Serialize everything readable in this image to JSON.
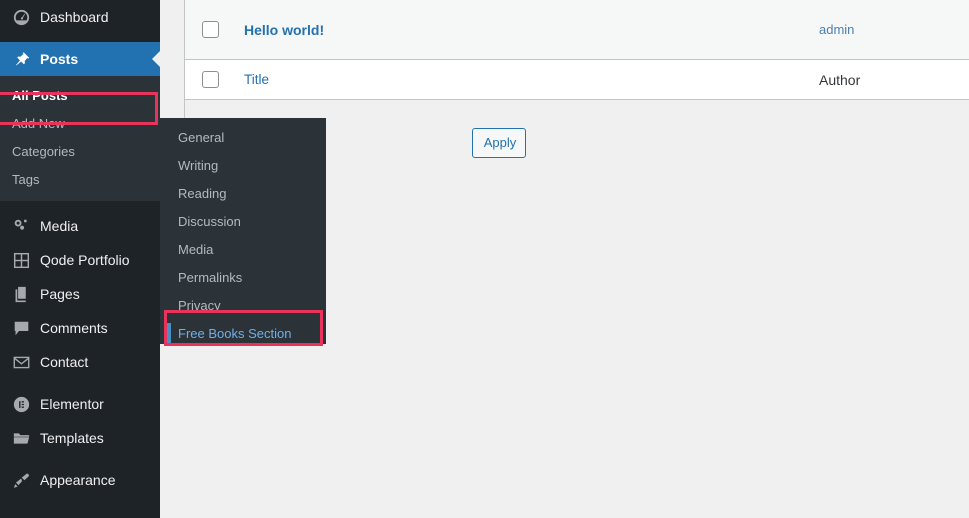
{
  "colors": {
    "sidebar_bg": "#1d2327",
    "submenu_bg": "#2c3338",
    "active_blue": "#2271b1",
    "link_blue": "#2271b1",
    "highlight_red": "#e8345a",
    "page_bg": "#f0f0f1",
    "selected_sub_blue": "#72aee6"
  },
  "sidebar": {
    "items": [
      {
        "label": "Dashboard",
        "icon": "dashboard-icon",
        "active": false
      },
      {
        "label": "Posts",
        "icon": "pin-icon",
        "active": true
      },
      {
        "label": "Media",
        "icon": "media-icon",
        "active": false
      },
      {
        "label": "Qode Portfolio",
        "icon": "grid-icon",
        "active": false
      },
      {
        "label": "Pages",
        "icon": "pages-icon",
        "active": false
      },
      {
        "label": "Comments",
        "icon": "comment-icon",
        "active": false
      },
      {
        "label": "Contact",
        "icon": "envelope-icon",
        "active": false
      },
      {
        "label": "Elementor",
        "icon": "elementor-icon",
        "active": false
      },
      {
        "label": "Templates",
        "icon": "folder-icon",
        "active": false
      },
      {
        "label": "Appearance",
        "icon": "brush-icon",
        "active": false
      }
    ],
    "posts_submenu": [
      {
        "label": "All Posts",
        "current": true
      },
      {
        "label": "Add New",
        "current": false
      },
      {
        "label": "Categories",
        "current": false
      },
      {
        "label": "Tags",
        "current": false
      }
    ]
  },
  "flyout": {
    "items": [
      {
        "label": "General",
        "selected": false
      },
      {
        "label": "Writing",
        "selected": false
      },
      {
        "label": "Reading",
        "selected": false
      },
      {
        "label": "Discussion",
        "selected": false
      },
      {
        "label": "Media",
        "selected": false
      },
      {
        "label": "Permalinks",
        "selected": false
      },
      {
        "label": "Privacy",
        "selected": false
      },
      {
        "label": "Free Books Section",
        "selected": true
      }
    ]
  },
  "post_list": {
    "rows": [
      {
        "title": "Hello world!",
        "author": "admin",
        "type": "data"
      },
      {
        "title": "Title",
        "author": "Author",
        "type": "header"
      }
    ]
  },
  "actions": {
    "apply_label": "Apply"
  },
  "annotations": [
    {
      "name": "all-posts-highlight",
      "target": "All Posts"
    },
    {
      "name": "free-books-section-highlight",
      "target": "Free Books Section"
    }
  ]
}
